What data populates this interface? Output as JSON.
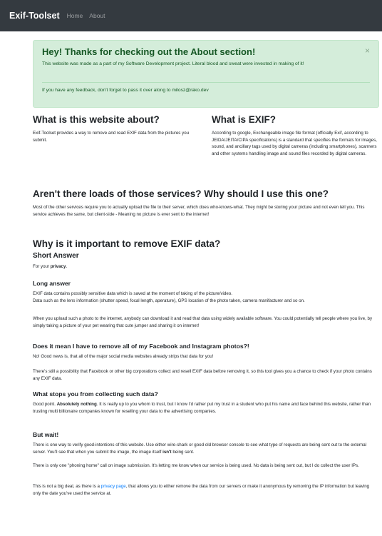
{
  "navbar": {
    "brand": "Exif-Toolset",
    "links": [
      "Home",
      "About"
    ]
  },
  "alert": {
    "heading": "Hey! Thanks for checking out the About section!",
    "close": "×",
    "text": "This website was made as a part of my Software Development project. Literal blood and sweat were invested in making of it!",
    "footer": "If you have any feedback, don't forget to pass it over along to milosz@rako.dev"
  },
  "about": {
    "title": "What is this website about?",
    "text": "Exif-Toolset provides a way to remove and read EXIF data from the pictures you submit."
  },
  "exif": {
    "title": "What is EXIF?",
    "text": "According to google, Exchangeable image file format (officially Exif, according to JEIDA/JEITA/CIPA specifications) is a standard that specifies the formats for images, sound, and ancillary tags used by digital cameras (including smartphones), scanners and other systems handling image and sound files recorded by digital cameras."
  },
  "services": {
    "title": "Aren't there loads of those services? Why should I use this one?",
    "text": "Most of the other services require you to actually upload the file to their server, which does who-knows-what. They might be storing your picture and not even tell you. This service achieves the same, but client-side - Meaning no picture is ever sent to the internet!"
  },
  "why": {
    "title": "Why is it important to remove EXIF data?",
    "short_title": "Short Answer",
    "short_prefix": "For your ",
    "short_bold": "privacy",
    "short_suffix": ".",
    "long_title": "Long answer",
    "long_p1": "EXIF data contains possibly sensitive data which is saved at the moment of taking of the picture/video.",
    "long_p2": "Data such as the lens information (shutter speed, focal length, aperature), GPS location of the photo taken, camera manifacturer and so on.",
    "long_p3": "When you upload such a photo to the internet, anybody can download it and read that data using widely available software. You could potentially tell people where you live, by simply taking a picture of your pet wearing that cute jumper and sharing it on internet!"
  },
  "facebook": {
    "title": "Does it mean I have to remove all of my Facebook and Instagram photos?!",
    "p1": "No! Good news is, that all of the major social media websites already strips that data for you!",
    "p2": "There's still a possibility that Facebook or other big corporations collect and resell EXIF data before removing it, so this tool gives you a chance to check if your photo contains any EXIF data."
  },
  "stops": {
    "title": "What stops you from collecting such data?",
    "prefix": "Good point. ",
    "bold": "Absolutely nothing",
    "rest": ". It is really up to you whom to trust, but I know I'd rather put my trust in a student who put his name and face behind this website, rather than trusting multi billionaire companies known for reselling your data to the advertising companies."
  },
  "wait": {
    "title": "But wait!",
    "p1_before": "There is one way to verify good-intentions of this website. Use either wire-shark or good old browser console to see what type of requests are being sent out to the external server. You'll see that when you submit the image, the image itself ",
    "p1_bold": "isn't",
    "p1_after": " being sent.",
    "p2": "There is only one \"phoning home\" call on image submission. It's letting me know when our service is being used. No data is being sent out, but I do collect the user IPs.",
    "p3_before": "This is not a big deal, as there is a ",
    "p3_link": "privacy page",
    "p3_after": ", that allows you to either remove the data from our servers or make it anonymous by removing the IP information but leaving only the date you've used the service at."
  }
}
